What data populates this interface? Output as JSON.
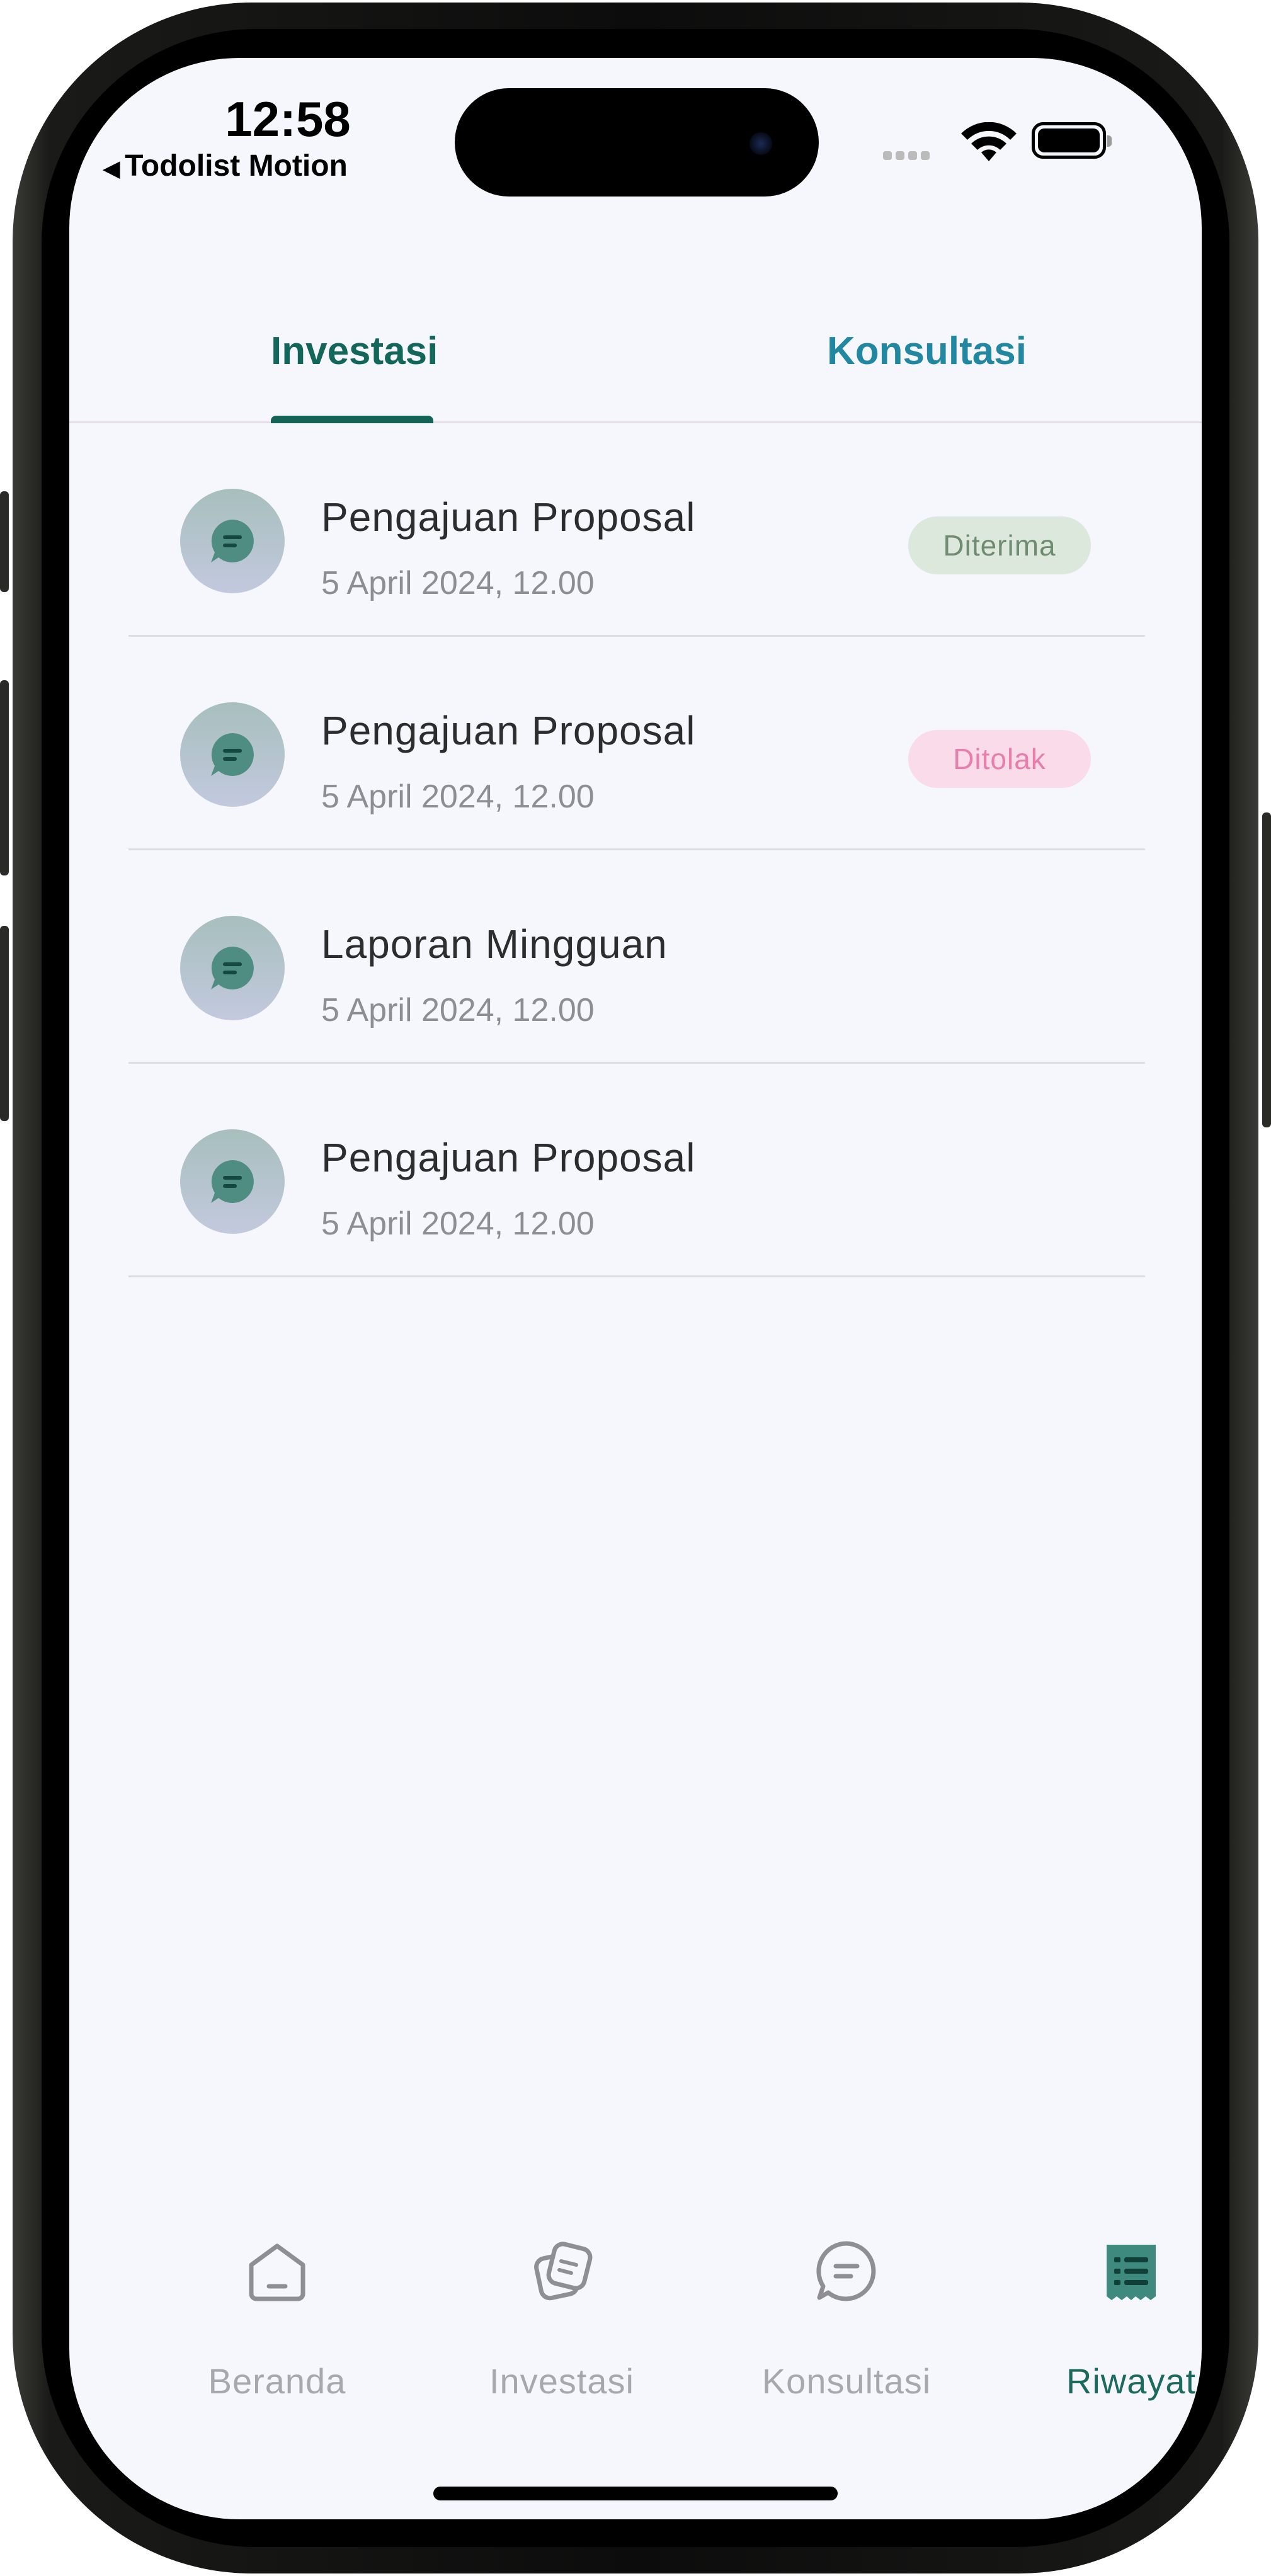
{
  "status_bar": {
    "time": "12:58",
    "back_app": "Todolist Motion"
  },
  "tabs": [
    {
      "label": "Investasi",
      "active": true
    },
    {
      "label": "Konsultasi",
      "active": false
    }
  ],
  "items": [
    {
      "title": "Pengajuan Proposal",
      "date": "5 April 2024, 12.00",
      "status": "Diterima",
      "status_type": "accepted"
    },
    {
      "title": "Pengajuan Proposal",
      "date": "5 April 2024, 12.00",
      "status": "Ditolak",
      "status_type": "rejected"
    },
    {
      "title": "Laporan Mingguan",
      "date": "5 April 2024, 12.00",
      "status": "",
      "status_type": "none"
    },
    {
      "title": "Pengajuan Proposal",
      "date": "5 April 2024, 12.00",
      "status": "",
      "status_type": "none"
    }
  ],
  "bottom_nav": [
    {
      "label": "Beranda",
      "icon": "home-icon",
      "active": false
    },
    {
      "label": "Investasi",
      "icon": "investment-icon",
      "active": false
    },
    {
      "label": "Konsultasi",
      "icon": "chat-icon",
      "active": false
    },
    {
      "label": "Riwayat",
      "icon": "history-list-icon",
      "active": true
    }
  ],
  "colors": {
    "primary": "#136456",
    "secondary_tab": "#2287a1",
    "background": "#f6f7fd",
    "accepted_bg": "#dde8dc",
    "rejected_bg": "#f9dbe9"
  }
}
